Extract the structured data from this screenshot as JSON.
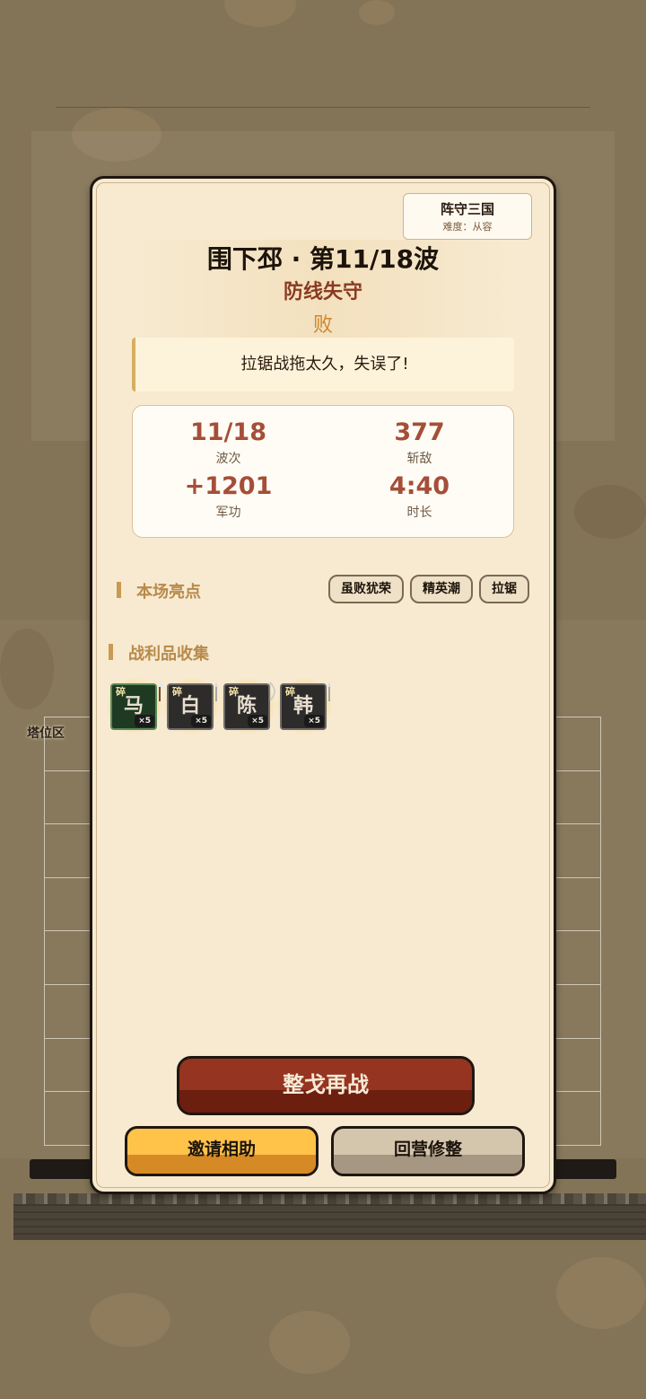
{
  "background": {
    "tower_zone_label": "塔位区",
    "grid_rows": 8
  },
  "mode": {
    "name": "阵守三国",
    "difficulty": "难度：从容"
  },
  "result": {
    "title": "围下邳 · 第11/18波",
    "subtitle": "防线失守",
    "outcome": "败",
    "message": "拉锯战拖太久，失误了!"
  },
  "stats": [
    {
      "value": "11/18",
      "label": "波次"
    },
    {
      "value": "377",
      "label": "斩敌"
    },
    {
      "value": "+1201",
      "label": "军功"
    },
    {
      "value": "4:40",
      "label": "时长"
    }
  ],
  "highlights": {
    "heading": "本场亮点",
    "tags": [
      "虽败犹荣",
      "精英潮",
      "拉锯"
    ]
  },
  "loot": {
    "heading": "战利品收集",
    "items": [
      {
        "char": "马",
        "frag": "碎",
        "count": "×5",
        "style": "green",
        "weapon": "axe"
      },
      {
        "char": "白",
        "frag": "碎",
        "count": "×5",
        "style": "dark",
        "weapon": "spear"
      },
      {
        "char": "陈",
        "frag": "碎",
        "count": "×5",
        "style": "dark",
        "weapon": "bow"
      },
      {
        "char": "韩",
        "frag": "碎",
        "count": "×5",
        "style": "dark",
        "weapon": "spear"
      }
    ]
  },
  "buttons": {
    "retry": "整戈再战",
    "invite": "邀请相助",
    "camp": "回营修整"
  },
  "colors": {
    "modal_bg": "#f7ead0",
    "accent_red": "#a54e38",
    "retry_btn": "#953420",
    "invite_btn": "#ffc34a",
    "camp_btn": "#d4c5ad"
  }
}
